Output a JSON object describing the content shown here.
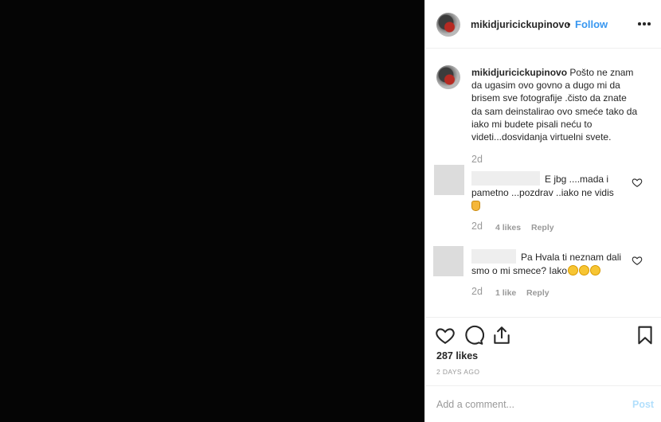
{
  "post": {
    "username": "mikidjuricickupinovo",
    "dot": "•",
    "follow_label": "Follow",
    "more_icon": "ellipsis-icon"
  },
  "caption": {
    "username": "mikidjuricickupinovo",
    "text": "Pošto ne znam da ugasim ovo govno a dugo mi da brisem sve fotografije .čisto da znate da sam deinstalirao ovo smeće tako da iako mi budete pisali neću to videti...dosvidanja virtuelni svete.",
    "time": "2d"
  },
  "comments": [
    {
      "text": "E jbg ....mada i pametno ...pozdrav ..iako ne vidis",
      "emoji": [
        "waving-hand"
      ],
      "time": "2d",
      "likes": "4 likes",
      "reply": "Reply"
    },
    {
      "text": "Pa Hvala ti neznam dali smo o mi smece? Iako",
      "emoji": [
        "rofl",
        "rofl",
        "rofl"
      ],
      "time": "2d",
      "likes": "1 like",
      "reply": "Reply"
    }
  ],
  "actions": {
    "likes": "287 likes",
    "date": "2 DAYS AGO",
    "icons": [
      "heart-icon",
      "comment-icon",
      "share-icon",
      "bookmark-icon"
    ]
  },
  "add_comment": {
    "placeholder": "Add a comment...",
    "post_label": "Post",
    "post_color": "#b2dffc"
  },
  "colors": {
    "accent": "#3897f0",
    "muted": "#999999",
    "media_bg": "#050505"
  }
}
